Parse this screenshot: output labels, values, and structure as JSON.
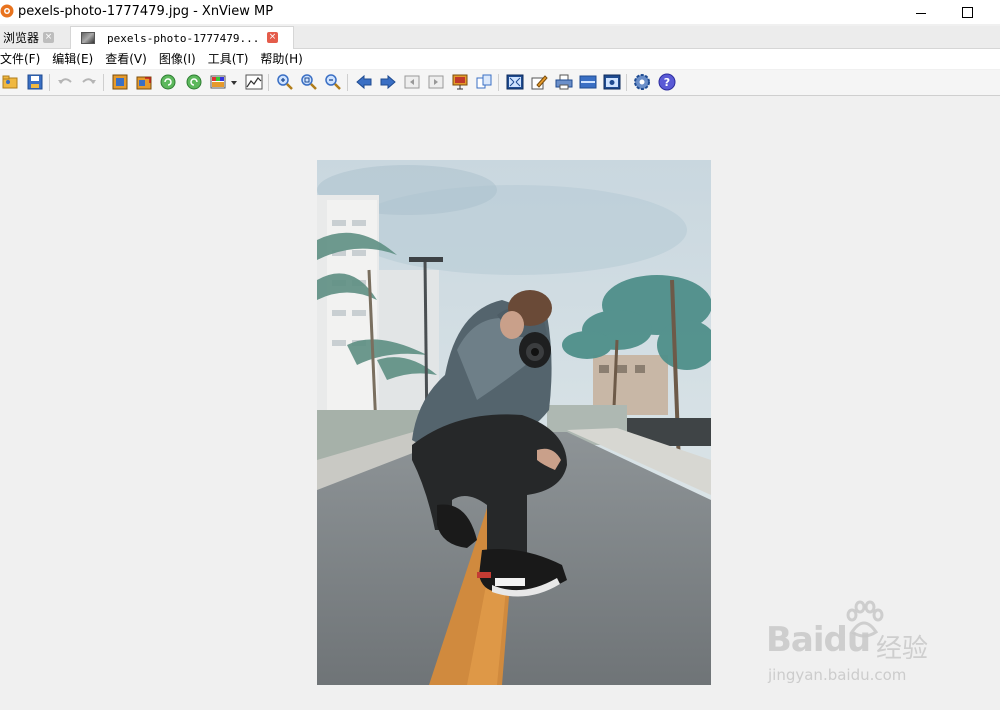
{
  "window": {
    "title": "pexels-photo-1777479.jpg - XnView MP"
  },
  "tabs": [
    {
      "label": "浏览器"
    },
    {
      "label": "pexels-photo-1777479..."
    }
  ],
  "menu": [
    "文件(F)",
    "编辑(E)",
    "查看(V)",
    "图像(I)",
    "工具(T)",
    "帮助(H)"
  ],
  "toolbar_icons": [
    "open-folder-icon",
    "save-icon",
    "undo-icon",
    "redo-icon",
    "crop-icon",
    "resize-icon",
    "rotate-left-icon",
    "rotate-right-icon",
    "color-adjust-icon",
    "dropdown-arrow-icon",
    "histogram-icon",
    "zoom-in-icon",
    "zoom-fit-icon",
    "zoom-out-icon",
    "previous-icon",
    "next-icon",
    "first-page-icon",
    "last-page-icon",
    "slideshow-icon",
    "compare-icon",
    "fullscreen-icon",
    "edit-icon",
    "print-icon",
    "scanner-icon",
    "capture-icon",
    "settings-icon",
    "help-icon"
  ],
  "watermark": {
    "logo": "Baidu",
    "text": "经验",
    "url": "jingyan.baidu.com"
  },
  "colors": {
    "accent_red": "#e45c4b",
    "icon_blue": "#3a6fc4",
    "icon_orange": "#e69a2b"
  }
}
